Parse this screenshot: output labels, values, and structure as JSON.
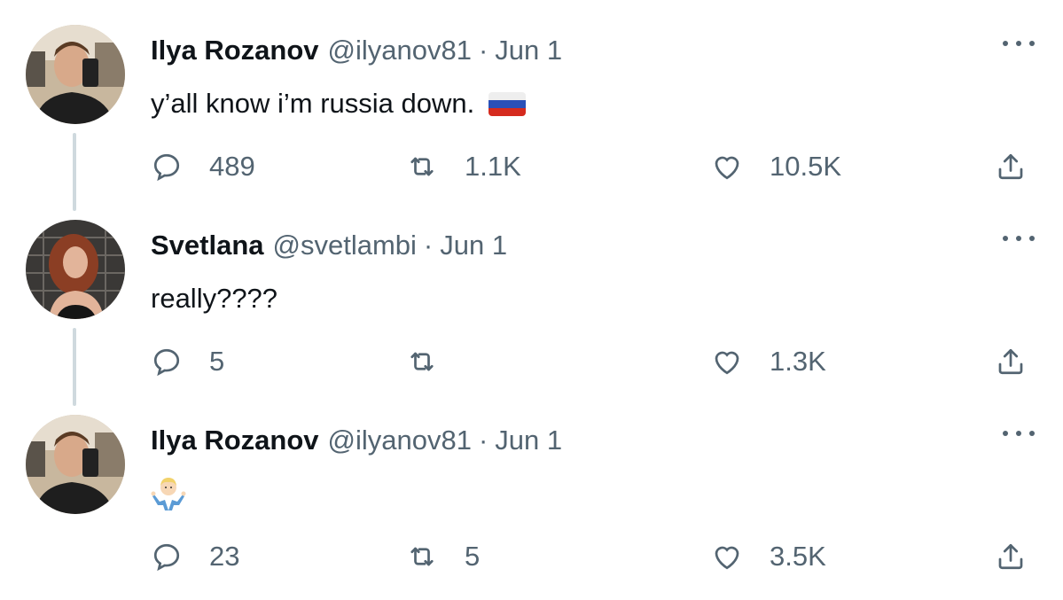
{
  "tweets": [
    {
      "name": "Ilya Rozanov",
      "handle": "@ilyanov81",
      "separator": "·",
      "date": "Jun 1",
      "text": "y’all know i’m russia down.",
      "attachment_emoji": "russia-flag",
      "replies": "489",
      "retweets": "1.1K",
      "likes": "10.5K"
    },
    {
      "name": "Svetlana",
      "handle": "@svetlambi",
      "separator": "·",
      "date": "Jun 1",
      "text": "really????",
      "replies": "5",
      "retweets": "",
      "likes": "1.3K"
    },
    {
      "name": "Ilya Rozanov",
      "handle": "@ilyanov81",
      "separator": "·",
      "date": "Jun 1",
      "text": "",
      "attachment_emoji": "man-shrugging",
      "replies": "23",
      "retweets": "5",
      "likes": "3.5K"
    }
  ],
  "icons": {
    "reply": "reply-icon",
    "retweet": "retweet-icon",
    "like": "heart-icon",
    "share": "share-icon",
    "more": "more-icon"
  },
  "colors": {
    "secondary_text": "#536471",
    "thread_line": "#cfd9de",
    "primary_text": "#0f1419"
  }
}
